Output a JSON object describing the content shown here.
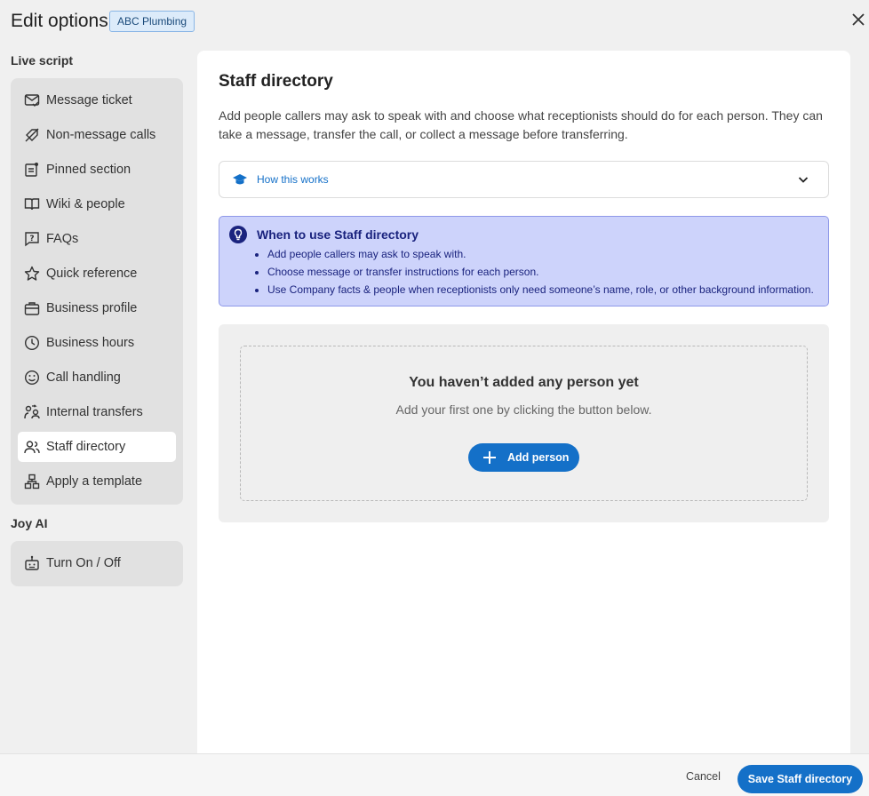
{
  "header": {
    "title": "Edit options",
    "badge": "ABC Plumbing"
  },
  "sidebar": {
    "live_script_label": "Live script",
    "items": [
      {
        "label": "Message ticket",
        "icon": "message-ticket-icon"
      },
      {
        "label": "Non-message calls",
        "icon": "crossed-tag-icon"
      },
      {
        "label": "Pinned section",
        "icon": "pinned-note-icon"
      },
      {
        "label": "Wiki & people",
        "icon": "book-icon"
      },
      {
        "label": "FAQs",
        "icon": "question-icon"
      },
      {
        "label": "Quick reference",
        "icon": "star-icon"
      },
      {
        "label": "Business profile",
        "icon": "briefcase-icon"
      },
      {
        "label": "Business hours",
        "icon": "clock-icon"
      },
      {
        "label": "Call handling",
        "icon": "smile-icon"
      },
      {
        "label": "Internal transfers",
        "icon": "transfer-people-icon"
      },
      {
        "label": "Staff directory",
        "icon": "people-icon",
        "active": true
      },
      {
        "label": "Apply a template",
        "icon": "template-icon"
      }
    ],
    "joy_ai_label": "Joy AI",
    "joy_items": [
      {
        "label": "Turn On / Off",
        "icon": "robot-icon"
      }
    ]
  },
  "main": {
    "title": "Staff directory",
    "description": "Add people callers may ask to speak with and choose what receptionists should do for each person. They can take a message, transfer the call, or collect a message before transferring.",
    "how_it_works": "How this works",
    "info": {
      "heading": "When to use Staff directory",
      "bullets": [
        "Add people callers may ask to speak with.",
        "Choose message or transfer instructions for each person.",
        "Use Company facts & people when receptionists only need someone’s name, role, or other background information."
      ]
    },
    "empty": {
      "title": "You haven’t added any person yet",
      "subtitle": "Add your first one by clicking the button below.",
      "button": "Add person"
    }
  },
  "footer": {
    "cancel": "Cancel",
    "save": "Save Staff directory"
  },
  "colors": {
    "accent": "#1470c8",
    "info_bg": "#cdd3fb",
    "info_text": "#1a237e"
  }
}
